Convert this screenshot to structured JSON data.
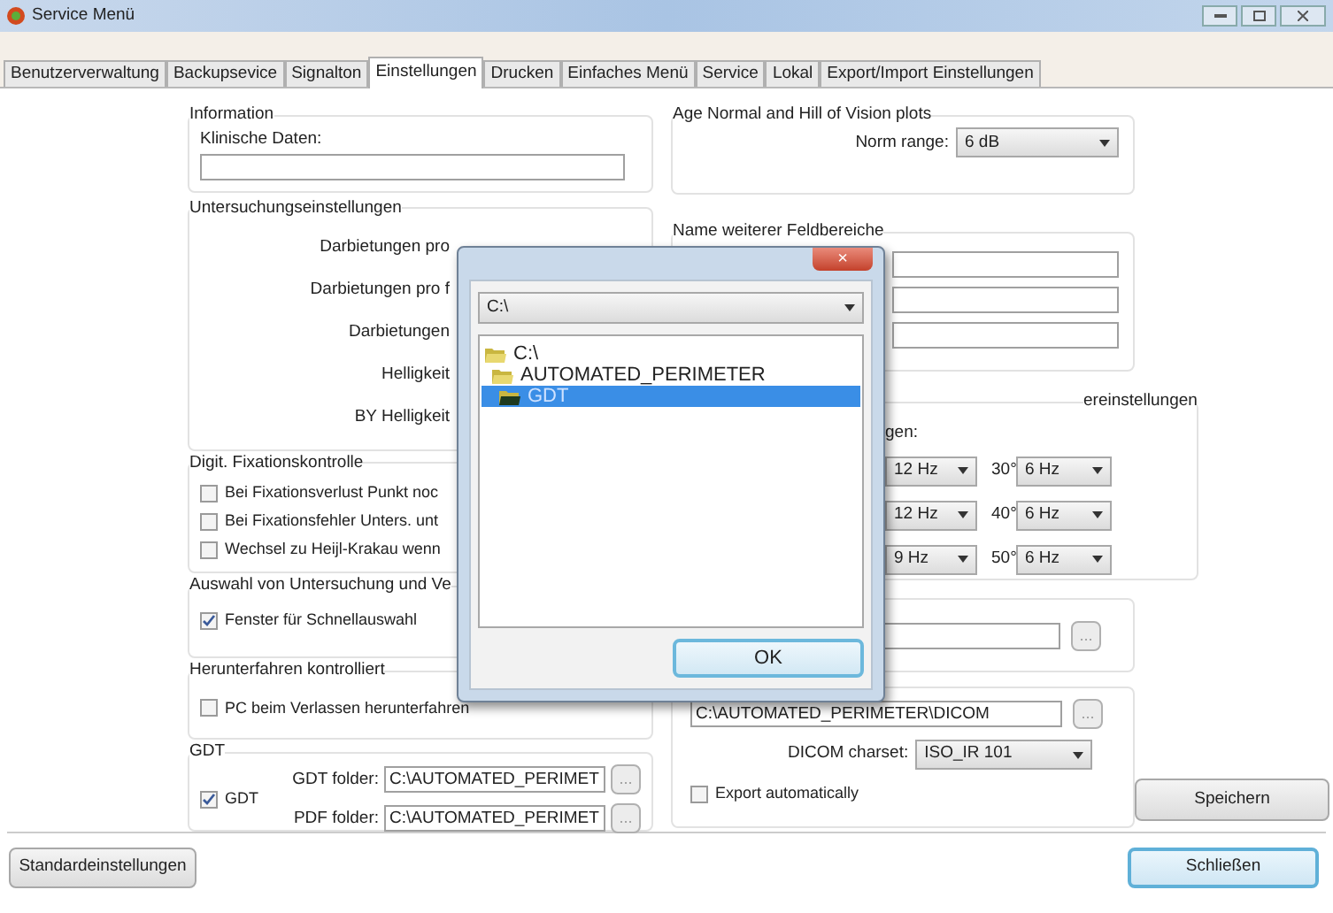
{
  "window": {
    "title": "Service Menü"
  },
  "tabs": [
    {
      "label": "Benutzerverwaltung",
      "selected": false
    },
    {
      "label": "Backupsevice",
      "selected": false
    },
    {
      "label": "Signalton",
      "selected": false
    },
    {
      "label": "Einstellungen",
      "selected": true
    },
    {
      "label": "Drucken",
      "selected": false
    },
    {
      "label": "Einfaches Menü",
      "selected": false
    },
    {
      "label": "Service",
      "selected": false
    },
    {
      "label": "Lokal",
      "selected": false
    },
    {
      "label": "Export/Import Einstellungen",
      "selected": false
    }
  ],
  "information": {
    "title": "Information",
    "label": "Klinische Daten:"
  },
  "untersuchung": {
    "title": "Untersuchungseinstellungen",
    "labels": [
      "Darbietungen pro",
      "Darbietungen pro f",
      "Darbietungen",
      "Helligkeit",
      "BY Helligkeit"
    ]
  },
  "fixation": {
    "title": "Digit. Fixationskontrolle",
    "options": [
      {
        "label": "Bei Fixationsverlust Punkt noc",
        "checked": false
      },
      {
        "label": "Bei Fixationsfehler Unters. unt",
        "checked": false
      },
      {
        "label": "Wechsel zu Heijl-Krakau wenn",
        "checked": false
      }
    ]
  },
  "auswahl": {
    "title": "Auswahl von Untersuchung und Ve",
    "option": {
      "label": "Fenster für Schnellauswahl",
      "checked": true
    }
  },
  "shutdown": {
    "title": "Herunterfahren kontrolliert",
    "option": {
      "label": "PC beim Verlassen herunterfahren",
      "checked": false
    }
  },
  "gdt": {
    "title": "GDT",
    "option": {
      "label": "GDT",
      "checked": true
    },
    "folders": [
      {
        "label": "GDT folder:",
        "value": "C:\\AUTOMATED_PERIMET",
        "button": "..."
      },
      {
        "label": "PDF folder:",
        "value": "C:\\AUTOMATED_PERIMET",
        "button": "..."
      }
    ]
  },
  "age_normal": {
    "title": "Age Normal and Hill of Vision plots",
    "label": "Norm range:",
    "value": "6 dB"
  },
  "feldbereiche": {
    "title": "Name weiterer Feldbereiche"
  },
  "frequencies": {
    "title": "ereinstellungen",
    "label": "gen:",
    "rows": [
      {
        "left": "12 Hz",
        "angle": "30°",
        "right": "6 Hz"
      },
      {
        "left": "12 Hz",
        "angle": "40°",
        "right": "6 Hz"
      },
      {
        "left": "9 Hz",
        "angle": "50°",
        "right": "6 Hz"
      }
    ]
  },
  "path_group": {
    "button": "..."
  },
  "dicom": {
    "path": "C:\\AUTOMATED_PERIMETER\\DICOM",
    "button": "...",
    "charset_label": "DICOM charset:",
    "charset": "ISO_IR 101",
    "export": {
      "label": "Export automatically",
      "checked": false
    }
  },
  "buttons": {
    "save": "Speichern",
    "defaults": "Standardeinstellungen",
    "close": "Schließen"
  },
  "dialog": {
    "close": "×",
    "drive": "C:\\",
    "ok": "OK",
    "tree": [
      {
        "label": "C:\\",
        "selected": false,
        "children": [
          {
            "label": "AUTOMATED_PERIMETER",
            "selected": false,
            "children": [
              {
                "label": "GDT",
                "selected": true
              }
            ]
          }
        ]
      }
    ]
  }
}
